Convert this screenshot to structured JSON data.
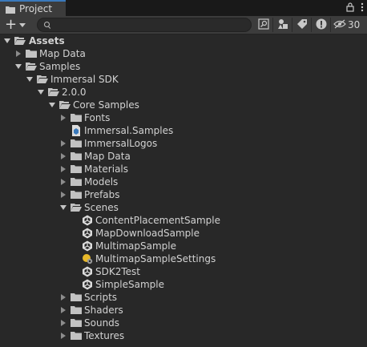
{
  "window": {
    "tab_label": "Project",
    "tab_icon": "folder-icon",
    "hidden_count": "30"
  },
  "search": {
    "value": "",
    "placeholder": ""
  },
  "tree": {
    "assets": {
      "label": "Assets",
      "expanded": true
    },
    "map_data_root": {
      "label": "Map Data",
      "expanded": false
    },
    "samples": {
      "label": "Samples",
      "expanded": true
    },
    "immersal_sdk": {
      "label": "Immersal SDK",
      "expanded": true
    },
    "version": {
      "label": "2.0.0",
      "expanded": true
    },
    "core_samples": {
      "label": "Core Samples",
      "expanded": true
    },
    "fonts": {
      "label": "Fonts",
      "expanded": false
    },
    "immersal_samples": {
      "label": "Immersal.Samples",
      "icon": "assembly-definition-icon"
    },
    "immersal_logos": {
      "label": "ImmersalLogos",
      "expanded": false
    },
    "map_data": {
      "label": "Map Data",
      "expanded": false
    },
    "materials": {
      "label": "Materials",
      "expanded": false
    },
    "models": {
      "label": "Models",
      "expanded": false
    },
    "prefabs": {
      "label": "Prefabs",
      "expanded": false
    },
    "scenes": {
      "label": "Scenes",
      "expanded": true
    },
    "content_placement": {
      "label": "ContentPlacementSample",
      "icon": "unity-scene-icon"
    },
    "map_download": {
      "label": "MapDownloadSample",
      "icon": "unity-scene-icon"
    },
    "multimap": {
      "label": "MultimapSample",
      "icon": "unity-scene-icon"
    },
    "multimap_settings": {
      "label": "MultimapSampleSettings",
      "icon": "lighting-settings-icon"
    },
    "sdk2test": {
      "label": "SDK2Test",
      "icon": "unity-scene-icon"
    },
    "simple_sample": {
      "label": "SimpleSample",
      "icon": "unity-scene-icon"
    },
    "scripts": {
      "label": "Scripts",
      "expanded": false
    },
    "shaders": {
      "label": "Shaders",
      "expanded": false
    },
    "sounds": {
      "label": "Sounds",
      "expanded": false
    },
    "textures": {
      "label": "Textures",
      "expanded": false
    }
  },
  "colors": {
    "background": "#282828",
    "toolbar": "#3c3c3c",
    "tab_accent": "#3a79bb",
    "folder": "#c2c2c2",
    "settings_icon": "#e8b92a"
  }
}
